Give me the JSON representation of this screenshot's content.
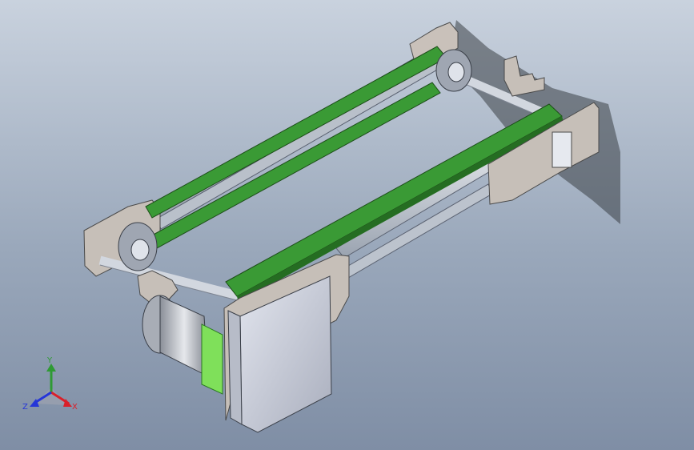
{
  "viewport": {
    "background_top": "#c9d2de",
    "background_bottom": "#7f8ea5"
  },
  "model": {
    "belt_color": "#3a9a35",
    "frame_color": "#c6bfb8",
    "rail_color": "#d9dde4",
    "motor_box_color": "#c3c7d3"
  },
  "triad": {
    "x_label": "X",
    "y_label": "Y",
    "z_label": "Z",
    "x_color": "#d9202a",
    "y_color": "#2f9a34",
    "z_color": "#2536d8"
  }
}
